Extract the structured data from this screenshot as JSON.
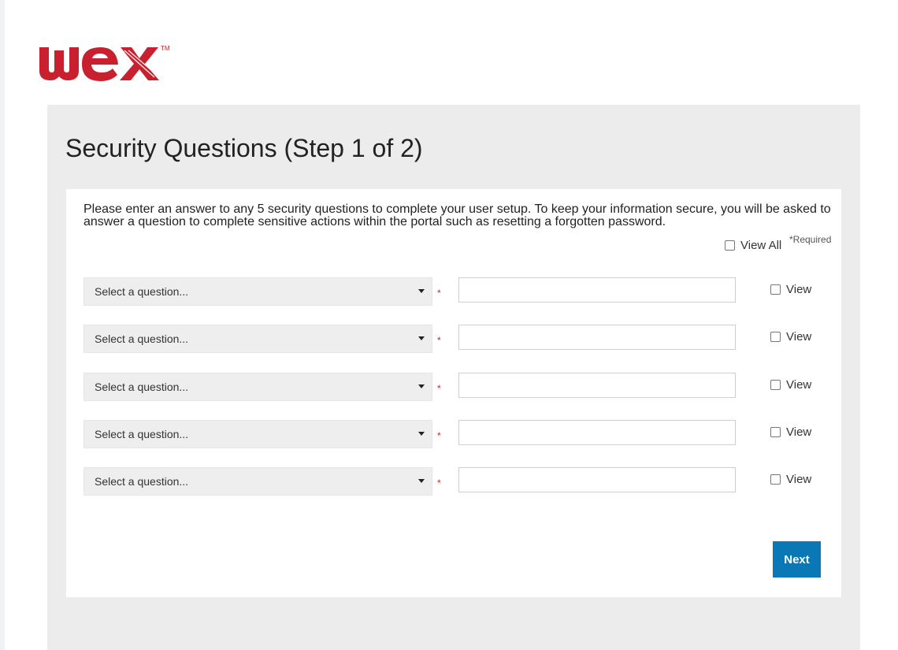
{
  "brand": {
    "logo_text": "wex",
    "trademark": "TM",
    "color": "#c8202f"
  },
  "page": {
    "title": "Security Questions (Step 1 of 2)"
  },
  "form": {
    "instructions": "Please enter an answer to any 5 security questions to complete your user setup. To keep your information secure, you will be asked to answer a question to complete sensitive actions within the portal such as resetting a forgotten password.",
    "required_note": "*Required",
    "view_all_label": "View All",
    "rows": [
      {
        "select_placeholder": "Select a question...",
        "required_mark": "*",
        "answer_value": "",
        "view_label": "View"
      },
      {
        "select_placeholder": "Select a question...",
        "required_mark": "*",
        "answer_value": "",
        "view_label": "View"
      },
      {
        "select_placeholder": "Select a question...",
        "required_mark": "*",
        "answer_value": "",
        "view_label": "View"
      },
      {
        "select_placeholder": "Select a question...",
        "required_mark": "*",
        "answer_value": "",
        "view_label": "View"
      },
      {
        "select_placeholder": "Select a question...",
        "required_mark": "*",
        "answer_value": "",
        "view_label": "View"
      }
    ],
    "next_label": "Next"
  },
  "colors": {
    "panel_bg": "#ececec",
    "card_bg": "#ffffff",
    "button_bg": "#0a78b4",
    "required_star": "#c0272d"
  },
  "icons": {
    "dropdown": "caret-down-icon",
    "checkbox": "checkbox-icon"
  }
}
